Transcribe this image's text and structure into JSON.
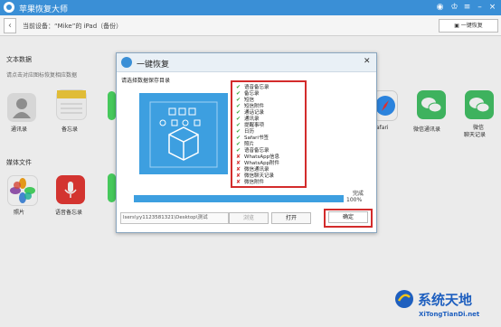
{
  "app": {
    "title": "苹果恢复大师",
    "icon": "app-logo-icon"
  },
  "window_controls": [
    "weibo-icon",
    "shirt-icon",
    "menu-icon",
    "minimize-icon",
    "close-icon"
  ],
  "toolbar": {
    "device_label": "当前设备：“Mike”的 iPad（备份）",
    "backup_button": "一键恢复"
  },
  "sections": {
    "text_data": {
      "title": "文本数据",
      "hint": "请点击对应图标恢复相应数据"
    },
    "media_files": {
      "title": "媒体文件"
    }
  },
  "tiles": {
    "contacts": {
      "label": "通讯录",
      "icon": "contacts-icon"
    },
    "notes": {
      "label": "备忘录",
      "icon": "notes-icon"
    },
    "safari": {
      "label": "afari",
      "icon": "safari-icon"
    },
    "wechat_contacts": {
      "label": "微信通讯录",
      "icon": "wechat-icon"
    },
    "wechat_chat": {
      "label": "微信聊天记录",
      "label_line1": "微信",
      "label_line2": "聊天记录",
      "icon": "wechat-icon"
    },
    "photos": {
      "label": "照片",
      "icon": "photos-icon"
    },
    "voice_memos": {
      "label": "语音备忘录",
      "icon": "microphone-icon"
    }
  },
  "dialog": {
    "title": "一键恢复",
    "prompt": "请选择数据保存目录",
    "items": [
      {
        "label": "语音备忘录",
        "status": "ok"
      },
      {
        "label": "备忘录",
        "status": "ok"
      },
      {
        "label": "短信",
        "status": "ok"
      },
      {
        "label": "短信附件",
        "status": "ok"
      },
      {
        "label": "通话记录",
        "status": "ok"
      },
      {
        "label": "通讯录",
        "status": "ok"
      },
      {
        "label": "提醒事项",
        "status": "ok"
      },
      {
        "label": "日历",
        "status": "ok"
      },
      {
        "label": "Safari书签",
        "status": "ok"
      },
      {
        "label": "照片",
        "status": "ok"
      },
      {
        "label": "语音备忘录",
        "status": "ok"
      },
      {
        "label": "WhatsApp信息",
        "status": "fail"
      },
      {
        "label": "WhatsApp附件",
        "status": "fail"
      },
      {
        "label": "微信通讯录",
        "status": "fail"
      },
      {
        "label": "微信聊天记录",
        "status": "fail"
      },
      {
        "label": "微信附件",
        "status": "fail"
      }
    ],
    "status_text": "完成",
    "progress": 1.0,
    "percent_text": "100%",
    "path_value": "lsers\\yy1123581321\\Desktop\\测试",
    "browse_label": "浏览",
    "open_label": "打开",
    "confirm_label": "确定"
  },
  "watermark": {
    "title": "系统天地",
    "url": "XiTongTianDi.net"
  },
  "colors": {
    "accent": "#3a8fd6",
    "highlight": "#d32b2b",
    "check": "#3fa83f"
  }
}
